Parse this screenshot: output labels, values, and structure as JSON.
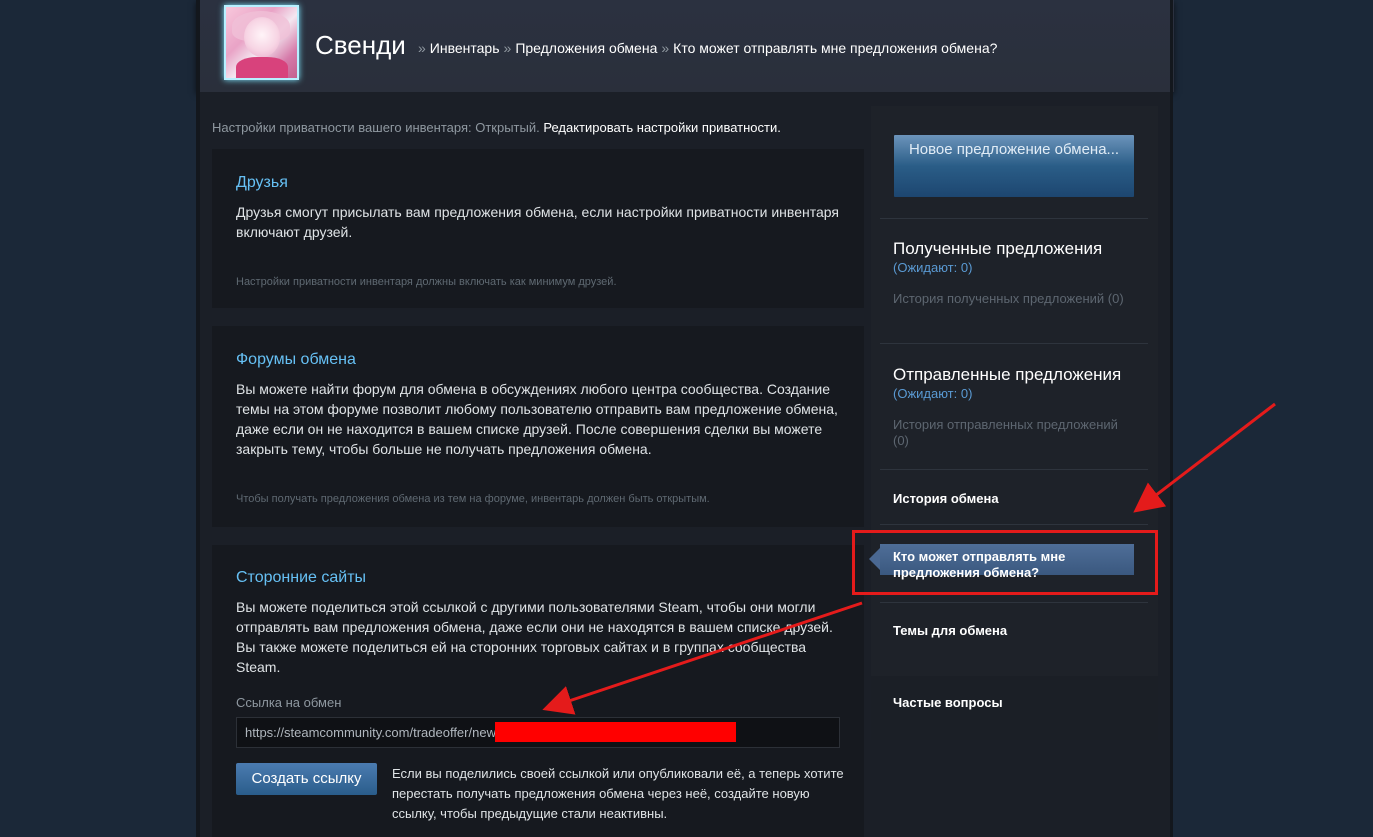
{
  "header": {
    "persona_name": "Свенди",
    "breadcrumbs": [
      "Инвентарь",
      "Предложения обмена",
      "Кто может отправлять мне предложения обмена?"
    ],
    "separator": "»"
  },
  "privacy": {
    "text": "Настройки приватности вашего инвентаря: Открытый.",
    "edit_link": "Редактировать настройки приватности."
  },
  "sections": {
    "friends": {
      "title": "Друзья",
      "description": "Друзья смогут присылать вам предложения обмена, если настройки приватности инвентаря включают друзей.",
      "note": "Настройки приватности инвентаря должны включать как минимум друзей."
    },
    "forums": {
      "title": "Форумы обмена",
      "description": "Вы можете найти форум для обмена в обсуждениях любого центра сообщества. Создание темы на этом форуме позволит любому пользователю отправить вам предложение обмена, даже если он не находится в вашем списке друзей. После совершения сделки вы можете закрыть тему, чтобы больше не получать предложения обмена.",
      "note": "Чтобы получать предложения обмена из тем на форуме, инвентарь должен быть открытым."
    },
    "third_party": {
      "title": "Сторонние сайты",
      "description": "Вы можете поделиться этой ссылкой с другими пользователями Steam, чтобы они могли отправлять вам предложения обмена, даже если они не находятся в вашем списке друзей. Вы также можете поделиться ей на сторонних торговых сайтах и в группах сообщества Steam.",
      "link_label": "Ссылка на обмен",
      "link_value": "https://steamcommunity.com/tradeoffer/new",
      "create_button": "Создать ссылку",
      "create_note": "Если вы поделились своей ссылкой или опубликовали её, а теперь хотите перестать получать предложения обмена через неё, создайте новую ссылку, чтобы предыдущие стали неактивны."
    }
  },
  "sidebar": {
    "new_offer_button": "Новое предложение обмена...",
    "received": {
      "title": "Полученные предложения",
      "waiting": "(Ожидают: 0)",
      "history": "История полученных предложений (0)"
    },
    "sent": {
      "title": "Отправленные предложения",
      "waiting": "(Ожидают: 0)",
      "history": "История отправленных предложений (0)"
    },
    "trade_history": "История обмена",
    "active_item": "Кто может отправлять мне предложения обмена?",
    "trade_topics": "Темы для обмена",
    "faq": "Частые вопросы"
  },
  "colors": {
    "accent_blue": "#66c0f4",
    "annotation_red": "#e41b1b",
    "redaction": "#ff0000"
  }
}
